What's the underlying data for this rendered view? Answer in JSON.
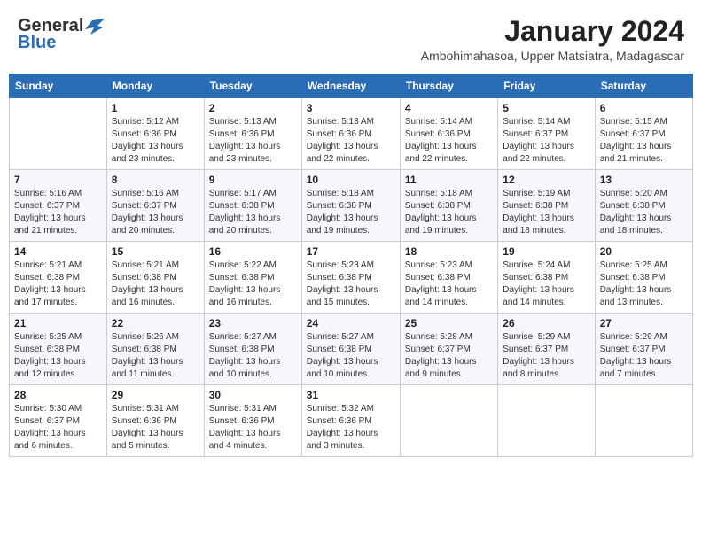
{
  "header": {
    "logo_general": "General",
    "logo_blue": "Blue",
    "month_year": "January 2024",
    "location": "Ambohimahasoa, Upper Matsiatra, Madagascar"
  },
  "weekdays": [
    "Sunday",
    "Monday",
    "Tuesday",
    "Wednesday",
    "Thursday",
    "Friday",
    "Saturday"
  ],
  "weeks": [
    [
      {
        "day": "",
        "info": ""
      },
      {
        "day": "1",
        "info": "Sunrise: 5:12 AM\nSunset: 6:36 PM\nDaylight: 13 hours\nand 23 minutes."
      },
      {
        "day": "2",
        "info": "Sunrise: 5:13 AM\nSunset: 6:36 PM\nDaylight: 13 hours\nand 23 minutes."
      },
      {
        "day": "3",
        "info": "Sunrise: 5:13 AM\nSunset: 6:36 PM\nDaylight: 13 hours\nand 22 minutes."
      },
      {
        "day": "4",
        "info": "Sunrise: 5:14 AM\nSunset: 6:36 PM\nDaylight: 13 hours\nand 22 minutes."
      },
      {
        "day": "5",
        "info": "Sunrise: 5:14 AM\nSunset: 6:37 PM\nDaylight: 13 hours\nand 22 minutes."
      },
      {
        "day": "6",
        "info": "Sunrise: 5:15 AM\nSunset: 6:37 PM\nDaylight: 13 hours\nand 21 minutes."
      }
    ],
    [
      {
        "day": "7",
        "info": "Sunrise: 5:16 AM\nSunset: 6:37 PM\nDaylight: 13 hours\nand 21 minutes."
      },
      {
        "day": "8",
        "info": "Sunrise: 5:16 AM\nSunset: 6:37 PM\nDaylight: 13 hours\nand 20 minutes."
      },
      {
        "day": "9",
        "info": "Sunrise: 5:17 AM\nSunset: 6:38 PM\nDaylight: 13 hours\nand 20 minutes."
      },
      {
        "day": "10",
        "info": "Sunrise: 5:18 AM\nSunset: 6:38 PM\nDaylight: 13 hours\nand 19 minutes."
      },
      {
        "day": "11",
        "info": "Sunrise: 5:18 AM\nSunset: 6:38 PM\nDaylight: 13 hours\nand 19 minutes."
      },
      {
        "day": "12",
        "info": "Sunrise: 5:19 AM\nSunset: 6:38 PM\nDaylight: 13 hours\nand 18 minutes."
      },
      {
        "day": "13",
        "info": "Sunrise: 5:20 AM\nSunset: 6:38 PM\nDaylight: 13 hours\nand 18 minutes."
      }
    ],
    [
      {
        "day": "14",
        "info": "Sunrise: 5:21 AM\nSunset: 6:38 PM\nDaylight: 13 hours\nand 17 minutes."
      },
      {
        "day": "15",
        "info": "Sunrise: 5:21 AM\nSunset: 6:38 PM\nDaylight: 13 hours\nand 16 minutes."
      },
      {
        "day": "16",
        "info": "Sunrise: 5:22 AM\nSunset: 6:38 PM\nDaylight: 13 hours\nand 16 minutes."
      },
      {
        "day": "17",
        "info": "Sunrise: 5:23 AM\nSunset: 6:38 PM\nDaylight: 13 hours\nand 15 minutes."
      },
      {
        "day": "18",
        "info": "Sunrise: 5:23 AM\nSunset: 6:38 PM\nDaylight: 13 hours\nand 14 minutes."
      },
      {
        "day": "19",
        "info": "Sunrise: 5:24 AM\nSunset: 6:38 PM\nDaylight: 13 hours\nand 14 minutes."
      },
      {
        "day": "20",
        "info": "Sunrise: 5:25 AM\nSunset: 6:38 PM\nDaylight: 13 hours\nand 13 minutes."
      }
    ],
    [
      {
        "day": "21",
        "info": "Sunrise: 5:25 AM\nSunset: 6:38 PM\nDaylight: 13 hours\nand 12 minutes."
      },
      {
        "day": "22",
        "info": "Sunrise: 5:26 AM\nSunset: 6:38 PM\nDaylight: 13 hours\nand 11 minutes."
      },
      {
        "day": "23",
        "info": "Sunrise: 5:27 AM\nSunset: 6:38 PM\nDaylight: 13 hours\nand 10 minutes."
      },
      {
        "day": "24",
        "info": "Sunrise: 5:27 AM\nSunset: 6:38 PM\nDaylight: 13 hours\nand 10 minutes."
      },
      {
        "day": "25",
        "info": "Sunrise: 5:28 AM\nSunset: 6:37 PM\nDaylight: 13 hours\nand 9 minutes."
      },
      {
        "day": "26",
        "info": "Sunrise: 5:29 AM\nSunset: 6:37 PM\nDaylight: 13 hours\nand 8 minutes."
      },
      {
        "day": "27",
        "info": "Sunrise: 5:29 AM\nSunset: 6:37 PM\nDaylight: 13 hours\nand 7 minutes."
      }
    ],
    [
      {
        "day": "28",
        "info": "Sunrise: 5:30 AM\nSunset: 6:37 PM\nDaylight: 13 hours\nand 6 minutes."
      },
      {
        "day": "29",
        "info": "Sunrise: 5:31 AM\nSunset: 6:36 PM\nDaylight: 13 hours\nand 5 minutes."
      },
      {
        "day": "30",
        "info": "Sunrise: 5:31 AM\nSunset: 6:36 PM\nDaylight: 13 hours\nand 4 minutes."
      },
      {
        "day": "31",
        "info": "Sunrise: 5:32 AM\nSunset: 6:36 PM\nDaylight: 13 hours\nand 3 minutes."
      },
      {
        "day": "",
        "info": ""
      },
      {
        "day": "",
        "info": ""
      },
      {
        "day": "",
        "info": ""
      }
    ]
  ]
}
